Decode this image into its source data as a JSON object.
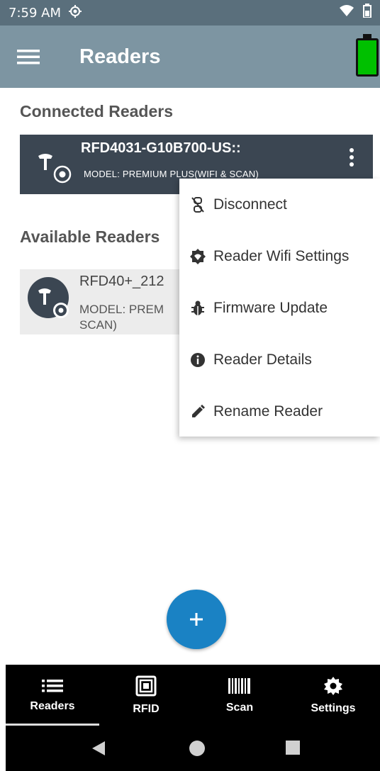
{
  "status_bar": {
    "time": "7:59 AM",
    "icons": [
      "gps-icon",
      "wifi-icon",
      "battery-icon"
    ]
  },
  "app_bar": {
    "title": "Readers",
    "menu_icon": "hamburger-icon",
    "battery_color": "#00c000"
  },
  "connected": {
    "heading": "Connected Readers",
    "reader": {
      "name": "RFD4031-G10B700-US::",
      "model": "MODEL: PREMIUM PLUS(WIFI & SCAN)"
    }
  },
  "available": {
    "heading": "Available Readers",
    "reader": {
      "name": "RFD40+_212",
      "model": "MODEL: PREM SCAN)"
    }
  },
  "popup_menu": {
    "items": [
      {
        "label": "Disconnect",
        "icon": "link-off-icon"
      },
      {
        "label": "Reader Wifi Settings",
        "icon": "wifi-gear-icon"
      },
      {
        "label": "Firmware Update",
        "icon": "firmware-icon"
      },
      {
        "label": "Reader Details",
        "icon": "info-icon"
      },
      {
        "label": "Rename Reader",
        "icon": "pencil-icon"
      }
    ]
  },
  "fab": {
    "label": "+"
  },
  "bottom_nav": {
    "tabs": [
      {
        "label": "Readers",
        "icon": "list-icon",
        "active": true
      },
      {
        "label": "RFID",
        "icon": "rfid-icon",
        "active": false
      },
      {
        "label": "Scan",
        "icon": "barcode-icon",
        "active": false
      },
      {
        "label": "Settings",
        "icon": "gear-icon",
        "active": false
      }
    ]
  },
  "colors": {
    "status_bar": "#5a6f7c",
    "app_bar": "#7d95a2",
    "connected_card": "#3b4652",
    "available_card": "#ececec",
    "fab": "#1a82c4"
  }
}
